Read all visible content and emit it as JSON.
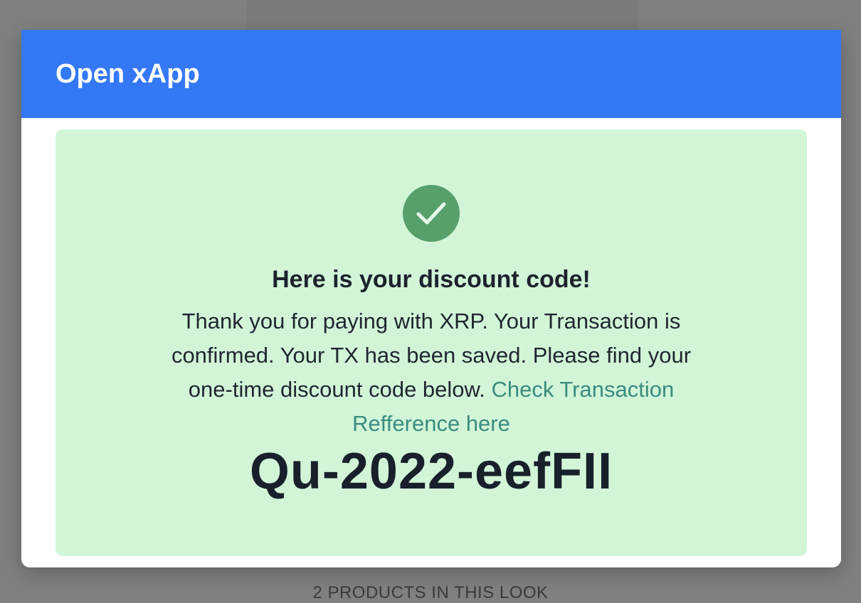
{
  "modal": {
    "title": "Open xApp"
  },
  "success": {
    "icon": "check-circle-icon",
    "heading": "Here is your discount code!",
    "message": "Thank you for paying with XRP. Your Transaction is confirmed. Your TX has been saved. Please find your one-time discount code below.",
    "link_label": "Check Transaction Refference here",
    "code": "Qu-2022-eefFII"
  },
  "background": {
    "footer_text": "2 PRODUCTS IN THIS LOOK"
  },
  "colors": {
    "header": "#3478f6",
    "panel": "#d2f5d8",
    "check": "#57a06c",
    "link": "#3a8c7f"
  }
}
